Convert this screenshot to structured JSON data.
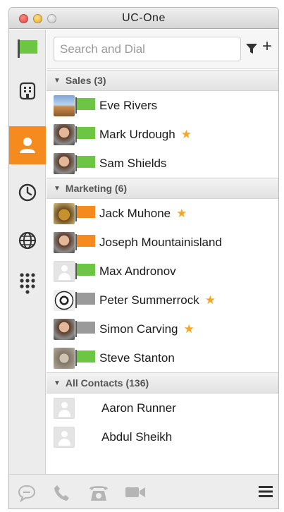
{
  "window": {
    "title": "UC-One"
  },
  "search": {
    "placeholder": "Search and Dial"
  },
  "toolbar": {
    "add_label": "+"
  },
  "groups": [
    {
      "name": "Sales (3)",
      "contacts": [
        {
          "name": "Eve Rivers",
          "flag": "#6cc644",
          "favorite": false,
          "avatar": "landscape"
        },
        {
          "name": "Mark Urdough",
          "flag": "#6cc644",
          "favorite": true,
          "avatar": "photo"
        },
        {
          "name": "Sam Shields",
          "flag": "#6cc644",
          "favorite": false,
          "avatar": "photo"
        }
      ]
    },
    {
      "name": "Marketing (6)",
      "contacts": [
        {
          "name": "Jack Muhone",
          "flag": "#f58a1f",
          "favorite": true,
          "avatar": "frog"
        },
        {
          "name": "Joseph Mountainisland",
          "flag": "#f58a1f",
          "favorite": false,
          "avatar": "photo"
        },
        {
          "name": "Max Andronov",
          "flag": "#6cc644",
          "favorite": false,
          "avatar": "placeholder"
        },
        {
          "name": "Peter Summerrock",
          "flag": "#9a9a9a",
          "favorite": true,
          "avatar": "soccer"
        },
        {
          "name": "Simon Carving",
          "flag": "#9a9a9a",
          "favorite": true,
          "avatar": "photo"
        },
        {
          "name": "Steve Stanton",
          "flag": "#6cc644",
          "favorite": false,
          "avatar": "animal"
        }
      ]
    },
    {
      "name": "All Contacts (136)",
      "contacts": [
        {
          "name": "Aaron Runner",
          "flag": null,
          "favorite": false,
          "avatar": "placeholder"
        },
        {
          "name": "Abdul Sheikh",
          "flag": null,
          "favorite": false,
          "avatar": "placeholder"
        }
      ]
    }
  ],
  "icons": {
    "favorite": "★",
    "group_toggle": "▼"
  },
  "colors": {
    "accent": "#f58a1f",
    "presence_available": "#6cc644",
    "presence_busy": "#f58a1f",
    "presence_offline": "#9a9a9a",
    "favorite": "#f5a623"
  },
  "sidebar": {
    "items": [
      {
        "name": "presence-flag",
        "active": false
      },
      {
        "name": "directory",
        "active": false
      },
      {
        "name": "contacts",
        "active": true
      },
      {
        "name": "history",
        "active": false
      },
      {
        "name": "web",
        "active": false
      },
      {
        "name": "dialpad",
        "active": false
      }
    ]
  }
}
